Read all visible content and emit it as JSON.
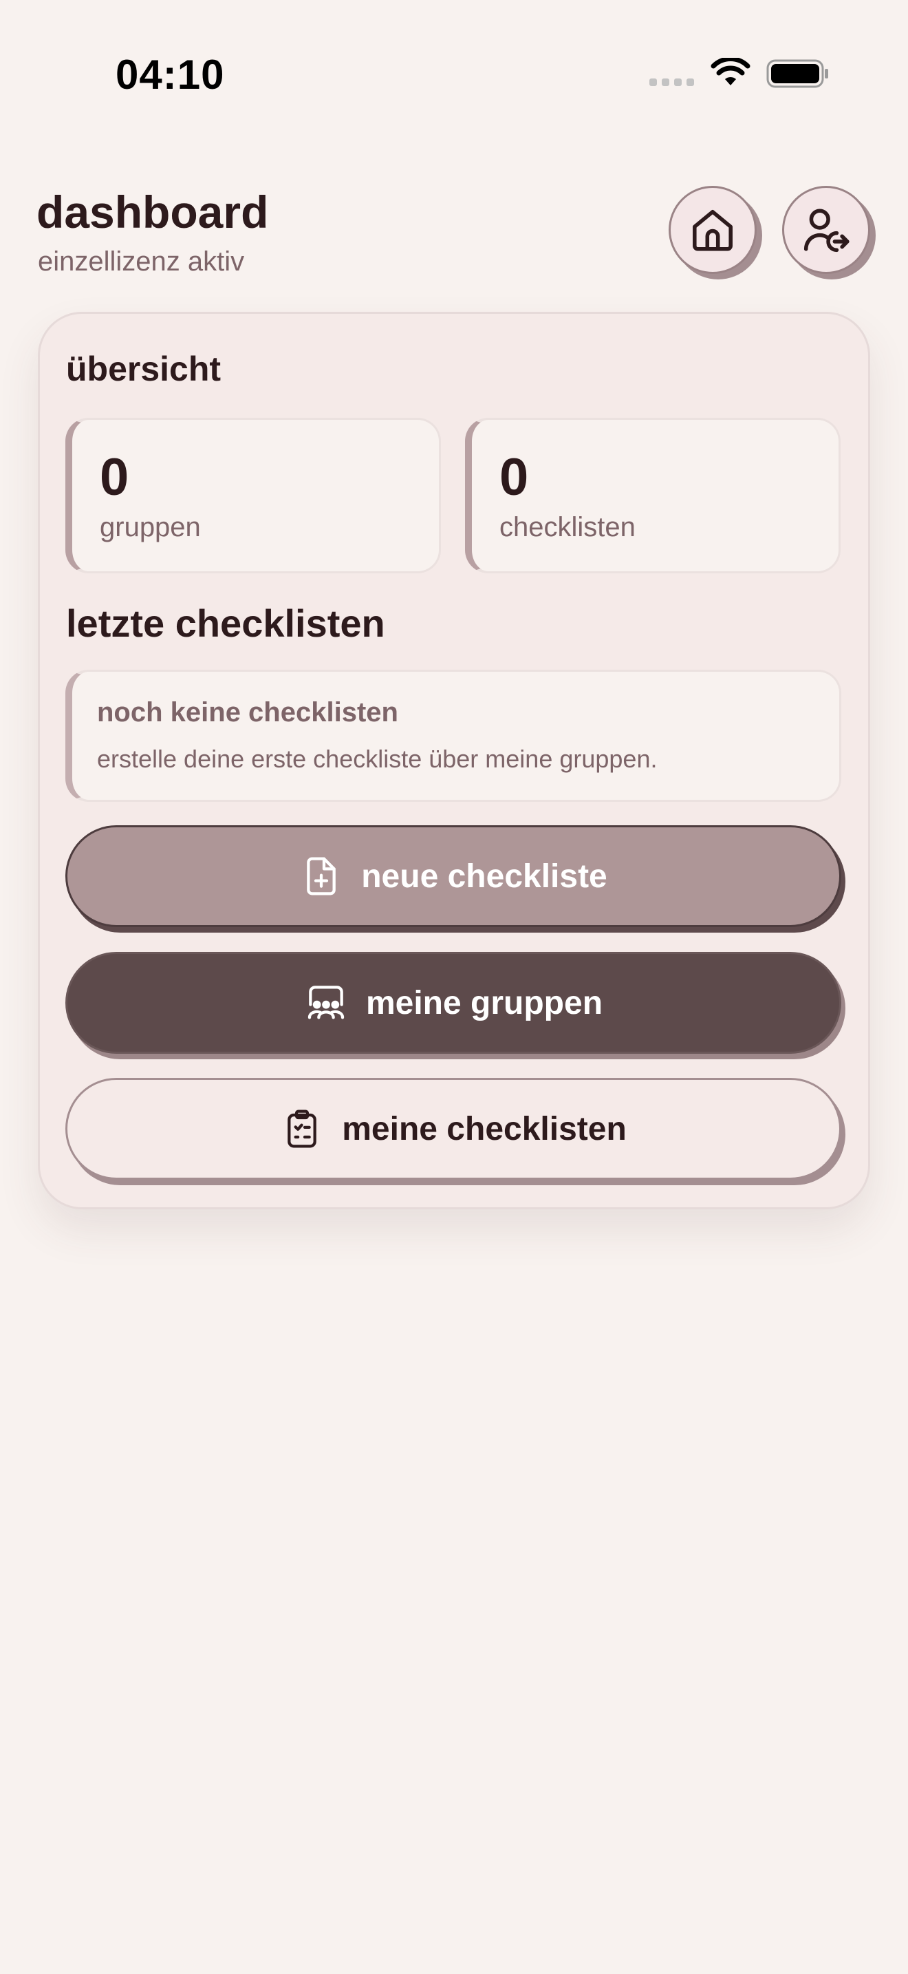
{
  "status_bar": {
    "time": "04:10",
    "icons": [
      "cellular-icon",
      "wifi-icon",
      "battery-icon"
    ]
  },
  "header": {
    "title": "dashboard",
    "subtitle": "einzellizenz aktiv",
    "home_button_icon": "home-icon",
    "logout_button_icon": "user-logout-icon"
  },
  "overview": {
    "heading": "übersicht",
    "stats": [
      {
        "value": "0",
        "label": "gruppen"
      },
      {
        "value": "0",
        "label": "checklisten"
      }
    ]
  },
  "recent": {
    "heading": "letzte checklisten",
    "empty_title": "noch keine checklisten",
    "empty_text": "erstelle deine erste checkliste über meine gruppen."
  },
  "actions": {
    "new_checklist": {
      "label": "neue checkliste",
      "icon": "file-plus-icon"
    },
    "my_groups": {
      "label": "meine gruppen",
      "icon": "groups-icon"
    },
    "my_checklists": {
      "label": "meine checklisten",
      "icon": "clipboard-list-icon"
    }
  },
  "colors": {
    "background": "#f8f2ef",
    "card": "#f5eae8",
    "text_dark": "#2d1a1c",
    "text_muted": "#7d6468",
    "accent_light": "#ae9697",
    "accent_dark": "#5d4a4b"
  }
}
